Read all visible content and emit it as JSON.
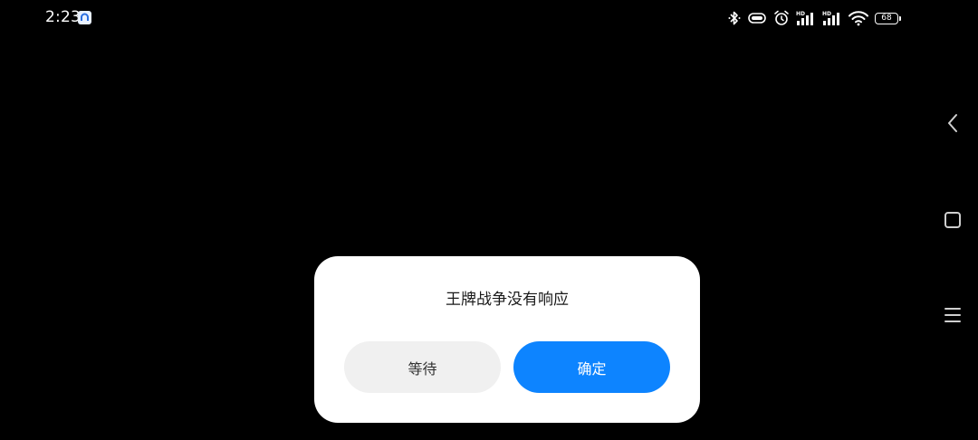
{
  "status_bar": {
    "time": "2:23",
    "notification_icon": "app-notification-icon",
    "icons": [
      "bluetooth-icon",
      "vibrate-icon",
      "alarm-icon",
      "signal-hd-1-icon",
      "signal-hd-2-icon",
      "wifi-icon",
      "battery-icon"
    ],
    "signal_label_1": "HD",
    "signal_label_2": "HD",
    "battery_level": "68"
  },
  "navigation": {
    "back": "back-icon",
    "home": "home-icon",
    "menu": "menu-icon"
  },
  "dialog": {
    "title": "王牌战争没有响应",
    "wait_label": "等待",
    "ok_label": "确定",
    "colors": {
      "ok_background": "#0d84ff",
      "wait_background": "#f0f0f0"
    }
  }
}
